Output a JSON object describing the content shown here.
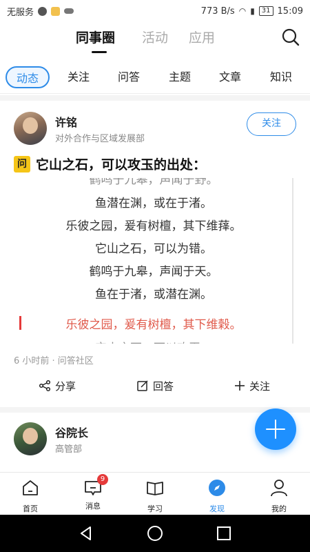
{
  "status_bar": {
    "carrier": "无服务",
    "speed": "773 B/s",
    "battery": "31",
    "time": "15:09"
  },
  "top_nav": {
    "tabs": [
      "同事圈",
      "活动",
      "应用"
    ],
    "active_tab": "同事圈"
  },
  "categories": {
    "items": [
      "动态",
      "关注",
      "问答",
      "主题",
      "文章",
      "知识"
    ],
    "active": "动态"
  },
  "post1": {
    "author": "许铭",
    "dept": "对外合作与区域发展部",
    "follow_label": "关注",
    "q_badge": "问",
    "title": "它山之石，可以攻玉的出处：",
    "poem": [
      "鹤鸣于九皋，声闻于野。",
      "鱼潜在渊，或在于渚。",
      "乐彼之园，爰有树檀，其下维萚。",
      "它山之石，可以为错。",
      "鹤鸣于九皋，声闻于天。",
      "鱼在于渚，或潜在渊。",
      "乐彼之园，爰有树檀，其下维榖。",
      "它山之石，可以攻玉。"
    ],
    "meta": "6 小时前 · 问答社区",
    "actions": {
      "share": "分享",
      "answer": "回答",
      "follow": "关注"
    }
  },
  "post2": {
    "author": "谷院长",
    "dept": "高管部"
  },
  "tab_bar": {
    "items": [
      "首页",
      "消息",
      "学习",
      "发现",
      "我的"
    ],
    "active": "发现",
    "message_badge": "9"
  },
  "colors": {
    "accent": "#2d8be8",
    "badge_yellow": "#f5c518",
    "highlight_red": "#e05a4b"
  }
}
